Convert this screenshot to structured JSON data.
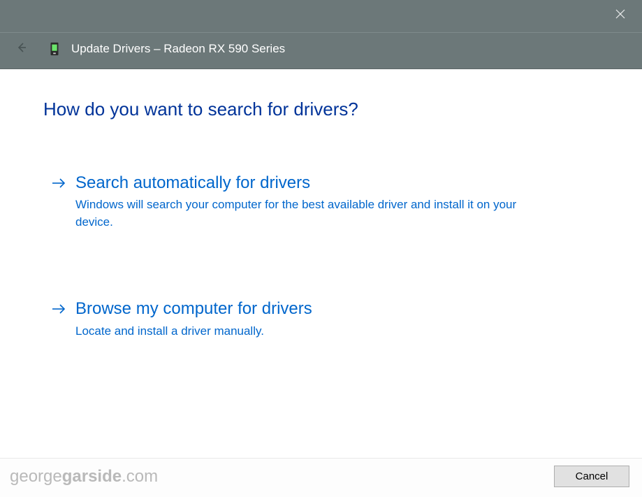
{
  "window": {
    "title": "Update Drivers – Radeon RX 590 Series"
  },
  "main": {
    "heading": "How do you want to search for drivers?",
    "options": [
      {
        "title": "Search automatically for drivers",
        "description": "Windows will search your computer for the best available driver and install it on your device."
      },
      {
        "title": "Browse my computer for drivers",
        "description": "Locate and install a driver manually."
      }
    ]
  },
  "footer": {
    "cancel_label": "Cancel"
  },
  "watermark": {
    "part1": "george",
    "part2": "garside",
    "part3": ".com"
  }
}
